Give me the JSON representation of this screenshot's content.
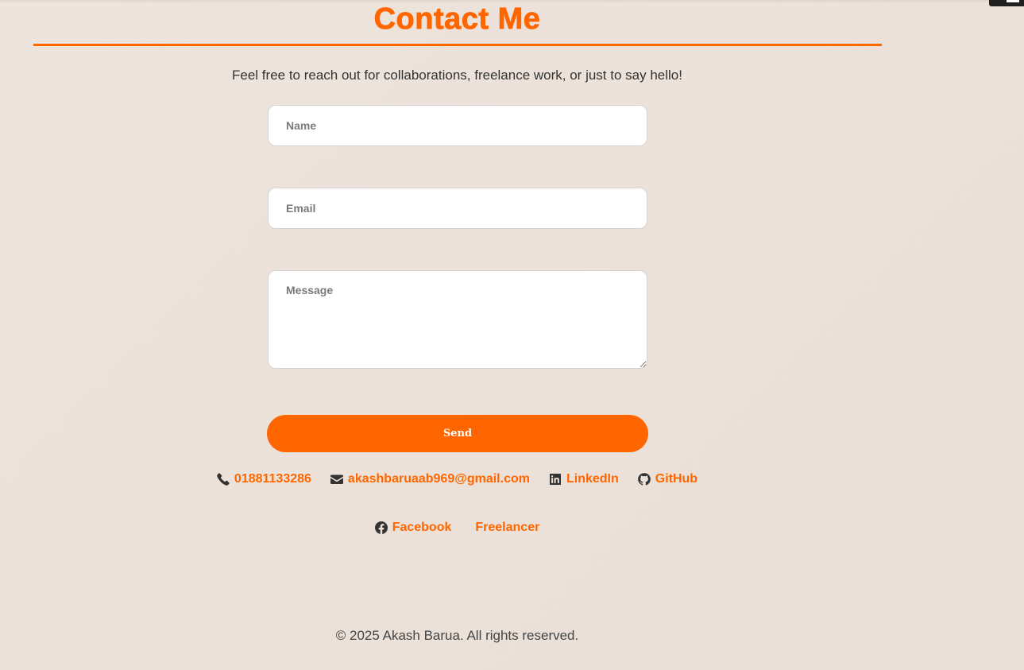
{
  "page": {
    "accent_color": "#ff6600",
    "background_color": "#ece2da"
  },
  "contact": {
    "title": "Contact Me",
    "intro": "Feel free to reach out for collaborations, freelance work, or just to say hello!"
  },
  "form": {
    "name_placeholder": "Name",
    "email_placeholder": "Email",
    "message_placeholder": "Message",
    "send_label": "Send"
  },
  "links_row_1": [
    {
      "icon": "phone-icon",
      "label": "01881133286"
    },
    {
      "icon": "envelope-icon",
      "label": "akashbaruaab969@gmail.com"
    },
    {
      "icon": "linkedin-icon",
      "label": "LinkedIn"
    },
    {
      "icon": "github-icon",
      "label": "GitHub"
    }
  ],
  "links_row_2": [
    {
      "icon": "facebook-icon",
      "label": "Facebook"
    },
    {
      "icon": "",
      "label": "Freelancer"
    }
  ],
  "footer": {
    "copyright": "© 2025 Akash Barua. All rights reserved."
  }
}
